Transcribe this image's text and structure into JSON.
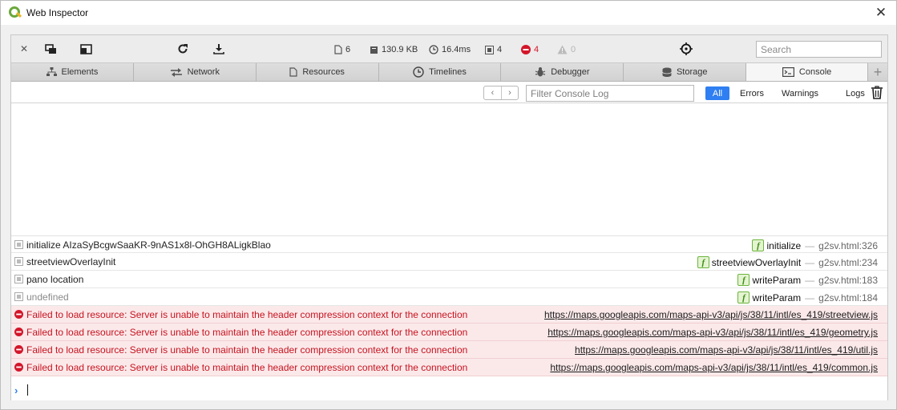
{
  "window": {
    "title": "Web Inspector",
    "close_glyph": "✕"
  },
  "toolbar": {
    "close_glyph": "✕",
    "stats": {
      "resources": "6",
      "size": "130.9 KB",
      "time": "16.4ms",
      "logs": "4",
      "errors": "4",
      "warnings": "0"
    },
    "search_placeholder": "Search"
  },
  "tabs": [
    {
      "label": "Elements",
      "icon": "elements-icon"
    },
    {
      "label": "Network",
      "icon": "network-icon"
    },
    {
      "label": "Resources",
      "icon": "resources-icon"
    },
    {
      "label": "Timelines",
      "icon": "timelines-icon"
    },
    {
      "label": "Debugger",
      "icon": "debugger-icon"
    },
    {
      "label": "Storage",
      "icon": "storage-icon"
    },
    {
      "label": "Console",
      "icon": "console-icon",
      "active": true
    }
  ],
  "tab_add_glyph": "+",
  "console": {
    "nav_prev": "‹",
    "nav_next": "›",
    "filter_placeholder": "Filter Console Log",
    "filters": [
      "All",
      "Errors",
      "Warnings",
      "Logs"
    ],
    "active_filter": "All",
    "messages": [
      {
        "level": "log",
        "text": "initialize AIzaSyBcgwSaaKR-9nAS1x8l-OhGH8ALigkBlao",
        "function": "initialize",
        "separator": "—",
        "location": "g2sv.html:326"
      },
      {
        "level": "log",
        "text": "streetviewOverlayInit",
        "function": "streetviewOverlayInit",
        "separator": "—",
        "location": "g2sv.html:234"
      },
      {
        "level": "log",
        "text": "pano location",
        "function": "writeParam",
        "separator": "—",
        "location": "g2sv.html:183"
      },
      {
        "level": "log-muted",
        "text": "undefined",
        "function": "writeParam",
        "separator": "—",
        "location": "g2sv.html:184"
      },
      {
        "level": "error",
        "text": "Failed to load resource: Server is unable to maintain the header compression context for the connection",
        "url": "https://maps.googleapis.com/maps-api-v3/api/js/38/11/intl/es_419/streetview.js"
      },
      {
        "level": "error",
        "text": "Failed to load resource: Server is unable to maintain the header compression context for the connection",
        "url": "https://maps.googleapis.com/maps-api-v3/api/js/38/11/intl/es_419/geometry.js"
      },
      {
        "level": "error",
        "text": "Failed to load resource: Server is unable to maintain the header compression context for the connection",
        "url": "https://maps.googleapis.com/maps-api-v3/api/js/38/11/intl/es_419/util.js"
      },
      {
        "level": "error",
        "text": "Failed to load resource: Server is unable to maintain the header compression context for the connection",
        "url": "https://maps.googleapis.com/maps-api-v3/api/js/38/11/intl/es_419/common.js"
      }
    ],
    "function_badge": "f",
    "prompt_glyph": "›"
  },
  "colors": {
    "error_text": "#c6131f",
    "error_bg": "#fbe9ea",
    "accent_blue": "#2f7ff2",
    "function_green": "#6cb43d"
  }
}
